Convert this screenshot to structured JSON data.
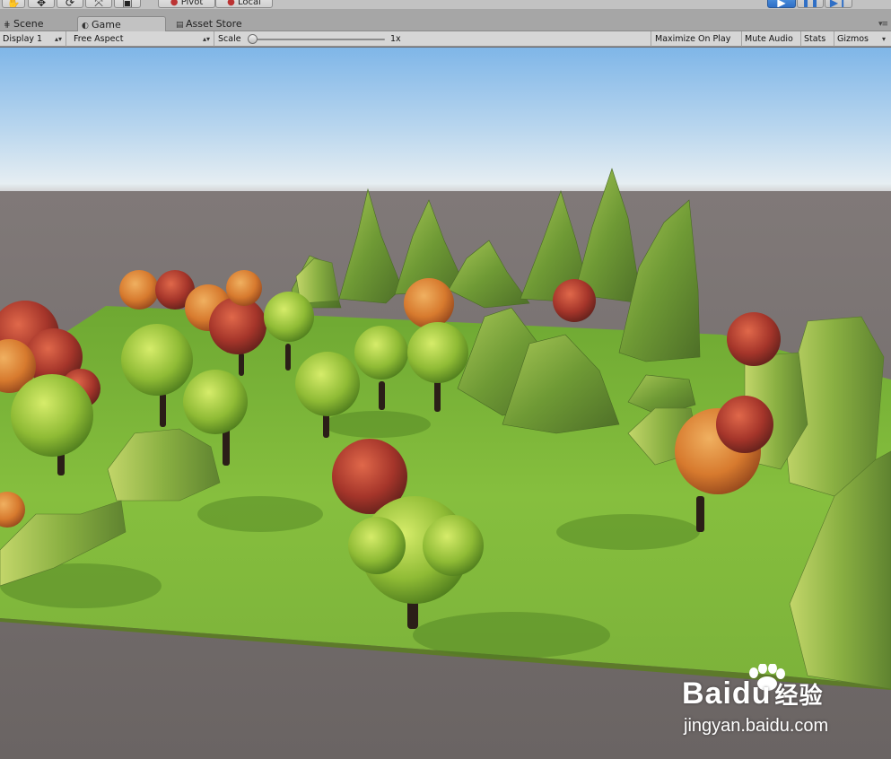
{
  "toolbar": {
    "tools": [
      {
        "name": "hand-tool-icon",
        "glyph": "✋"
      },
      {
        "name": "move-tool-icon",
        "glyph": "✥"
      },
      {
        "name": "rotate-tool-icon",
        "glyph": "⟳"
      },
      {
        "name": "scale-tool-icon",
        "glyph": "⤧"
      },
      {
        "name": "rect-tool-icon",
        "glyph": "▣"
      }
    ],
    "pivot_label": "Pivot",
    "local_label": "Local",
    "play_controls": [
      "play-icon",
      "pause-icon",
      "step-icon"
    ]
  },
  "tabs": [
    {
      "label": "Scene",
      "icon": "scene-icon",
      "active": false
    },
    {
      "label": "Game",
      "icon": "game-icon",
      "active": true
    },
    {
      "label": "Asset Store",
      "icon": "asset-store-icon",
      "active": false
    }
  ],
  "game_toolbar": {
    "display": "Display 1",
    "aspect": "Free Aspect",
    "scale_label": "Scale",
    "scale_value": "1x",
    "scale_level": 0.0,
    "maximize_on_play": "Maximize On Play",
    "mute_audio": "Mute Audio",
    "stats": "Stats",
    "gizmos": "Gizmos"
  },
  "watermark": {
    "brand": "Bai",
    "brand_suffix": "du",
    "brand_cn": "经验",
    "url": "jingyan.baidu.com"
  },
  "colors": {
    "sky_top": "#7fb6e8",
    "horizon": "#e3eef4",
    "ground_far": "#6e6866",
    "grass": "#7fb83a",
    "play_blue": "#3b7fd8"
  }
}
